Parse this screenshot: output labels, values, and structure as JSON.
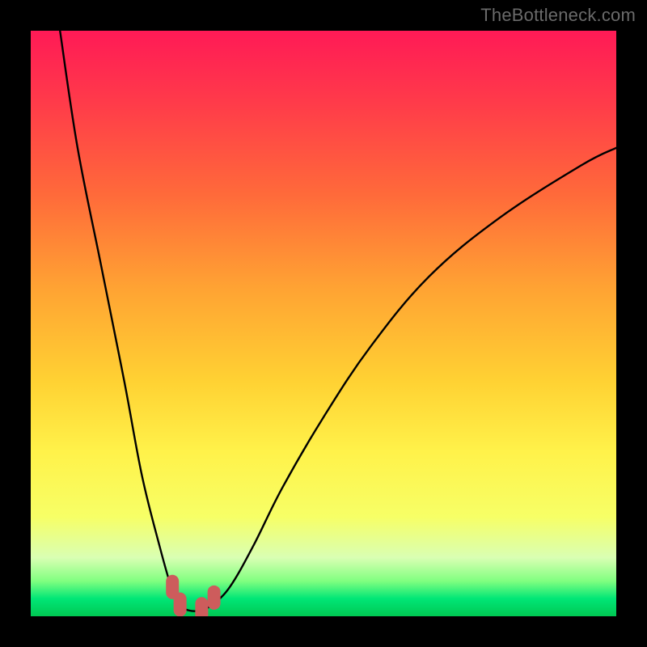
{
  "watermark": "TheBottleneck.com",
  "chart_data": {
    "type": "line",
    "title": "",
    "xlabel": "",
    "ylabel": "",
    "xlim": [
      0,
      100
    ],
    "ylim": [
      0,
      100
    ],
    "grid": false,
    "legend": false,
    "series": [
      {
        "name": "bottleneck-curve",
        "x": [
          5,
          8,
          12,
          16,
          19,
          22,
          24,
          25.5,
          27,
          29,
          31,
          34,
          38,
          43,
          50,
          58,
          68,
          80,
          94,
          100
        ],
        "y": [
          100,
          80,
          60,
          40,
          24,
          12,
          5,
          2,
          1,
          1,
          2,
          5,
          12,
          22,
          34,
          46,
          58,
          68,
          77,
          80
        ]
      }
    ],
    "markers": [
      {
        "name": "marker-left-upper",
        "x": 24.2,
        "y": 5.0
      },
      {
        "name": "marker-left-lower",
        "x": 25.5,
        "y": 2.0
      },
      {
        "name": "marker-right-lower",
        "x": 29.2,
        "y": 1.2
      },
      {
        "name": "marker-right-upper",
        "x": 31.3,
        "y": 3.2
      }
    ],
    "gradient_stops": [
      {
        "pct": 0,
        "color": "#ff1a56"
      },
      {
        "pct": 12,
        "color": "#ff3a4a"
      },
      {
        "pct": 28,
        "color": "#ff6a3a"
      },
      {
        "pct": 44,
        "color": "#ffa333"
      },
      {
        "pct": 60,
        "color": "#ffd233"
      },
      {
        "pct": 72,
        "color": "#fff24a"
      },
      {
        "pct": 83,
        "color": "#f7ff66"
      },
      {
        "pct": 90,
        "color": "#d9ffb3"
      },
      {
        "pct": 94,
        "color": "#80ff80"
      },
      {
        "pct": 97,
        "color": "#00e676"
      },
      {
        "pct": 100,
        "color": "#00c853"
      }
    ],
    "marker_color": "#cd5c5c",
    "line_color": "#000000"
  }
}
